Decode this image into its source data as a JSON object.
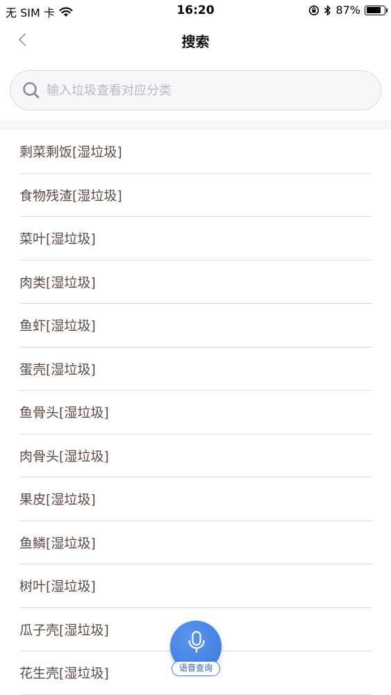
{
  "status_bar": {
    "carrier": "无 SIM 卡",
    "time": "16:20",
    "battery_percent": "87%",
    "battery_level": 0.87,
    "icons": [
      "wifi-icon",
      "rotation-lock-icon",
      "bluetooth-icon",
      "battery-icon"
    ]
  },
  "nav": {
    "title": "搜索",
    "back_icon": "chevron-left-icon"
  },
  "search": {
    "placeholder": "输入垃圾查看对应分类",
    "value": "",
    "icon": "search-icon"
  },
  "results": [
    "剩菜剩饭[湿垃圾]",
    "食物残渣[湿垃圾]",
    "菜叶[湿垃圾]",
    "肉类[湿垃圾]",
    "鱼虾[湿垃圾]",
    "蛋壳[湿垃圾]",
    "鱼骨头[湿垃圾]",
    "肉骨头[湿垃圾]",
    "果皮[湿垃圾]",
    "鱼鳞[湿垃圾]",
    "树叶[湿垃圾]",
    "瓜子壳[湿垃圾]",
    "花生壳[湿垃圾]"
  ],
  "voice": {
    "label": "语音查询",
    "icon": "microphone-icon"
  },
  "colors": {
    "accent": "#3a78df",
    "item_text": "#5c4a43",
    "placeholder": "#b9b9be"
  }
}
